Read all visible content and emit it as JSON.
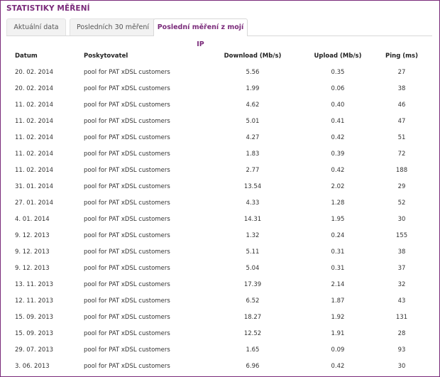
{
  "section_title": "STATISTIKY MĚŘENÍ",
  "tabs": [
    {
      "label": "Aktuální data"
    },
    {
      "label": "Posledních 30 měření"
    },
    {
      "label": "Poslední měření z mojí IP"
    }
  ],
  "active_tab_color": "#7a2a7a",
  "table": {
    "headers": {
      "date": "Datum",
      "provider": "Poskytovatel",
      "download": "Download (Mb/s)",
      "upload": "Upload (Mb/s)",
      "ping": "Ping (ms)"
    },
    "rows": [
      {
        "date": "20. 02. 2014",
        "provider": "pool for PAT xDSL customers",
        "download": "5.56",
        "upload": "0.35",
        "ping": "27"
      },
      {
        "date": "20. 02. 2014",
        "provider": "pool for PAT xDSL customers",
        "download": "1.99",
        "upload": "0.06",
        "ping": "38"
      },
      {
        "date": "11. 02. 2014",
        "provider": "pool for PAT xDSL customers",
        "download": "4.62",
        "upload": "0.40",
        "ping": "46"
      },
      {
        "date": "11. 02. 2014",
        "provider": "pool for PAT xDSL customers",
        "download": "5.01",
        "upload": "0.41",
        "ping": "47"
      },
      {
        "date": "11. 02. 2014",
        "provider": "pool for PAT xDSL customers",
        "download": "4.27",
        "upload": "0.42",
        "ping": "51"
      },
      {
        "date": "11. 02. 2014",
        "provider": "pool for PAT xDSL customers",
        "download": "1.83",
        "upload": "0.39",
        "ping": "72"
      },
      {
        "date": "11. 02. 2014",
        "provider": "pool for PAT xDSL customers",
        "download": "2.77",
        "upload": "0.42",
        "ping": "188"
      },
      {
        "date": "31. 01. 2014",
        "provider": "pool for PAT xDSL customers",
        "download": "13.54",
        "upload": "2.02",
        "ping": "29"
      },
      {
        "date": "27. 01. 2014",
        "provider": "pool for PAT xDSL customers",
        "download": "4.33",
        "upload": "1.28",
        "ping": "52"
      },
      {
        "date": "4. 01. 2014",
        "provider": "pool for PAT xDSL customers",
        "download": "14.31",
        "upload": "1.95",
        "ping": "30"
      },
      {
        "date": "9. 12. 2013",
        "provider": "pool for PAT xDSL customers",
        "download": "1.32",
        "upload": "0.24",
        "ping": "155"
      },
      {
        "date": "9. 12. 2013",
        "provider": "pool for PAT xDSL customers",
        "download": "5.11",
        "upload": "0.31",
        "ping": "38"
      },
      {
        "date": "9. 12. 2013",
        "provider": "pool for PAT xDSL customers",
        "download": "5.04",
        "upload": "0.31",
        "ping": "37"
      },
      {
        "date": "13. 11. 2013",
        "provider": "pool for PAT xDSL customers",
        "download": "17.39",
        "upload": "2.14",
        "ping": "32"
      },
      {
        "date": "12. 11. 2013",
        "provider": "pool for PAT xDSL customers",
        "download": "6.52",
        "upload": "1.87",
        "ping": "43"
      },
      {
        "date": "15. 09. 2013",
        "provider": "pool for PAT xDSL customers",
        "download": "18.27",
        "upload": "1.92",
        "ping": "131"
      },
      {
        "date": "15. 09. 2013",
        "provider": "pool for PAT xDSL customers",
        "download": "12.52",
        "upload": "1.91",
        "ping": "28"
      },
      {
        "date": "29. 07. 2013",
        "provider": "pool for PAT xDSL customers",
        "download": "1.65",
        "upload": "0.09",
        "ping": "93"
      },
      {
        "date": "3. 06. 2013",
        "provider": "pool for PAT xDSL customers",
        "download": "6.96",
        "upload": "0.42",
        "ping": "30"
      }
    ]
  }
}
